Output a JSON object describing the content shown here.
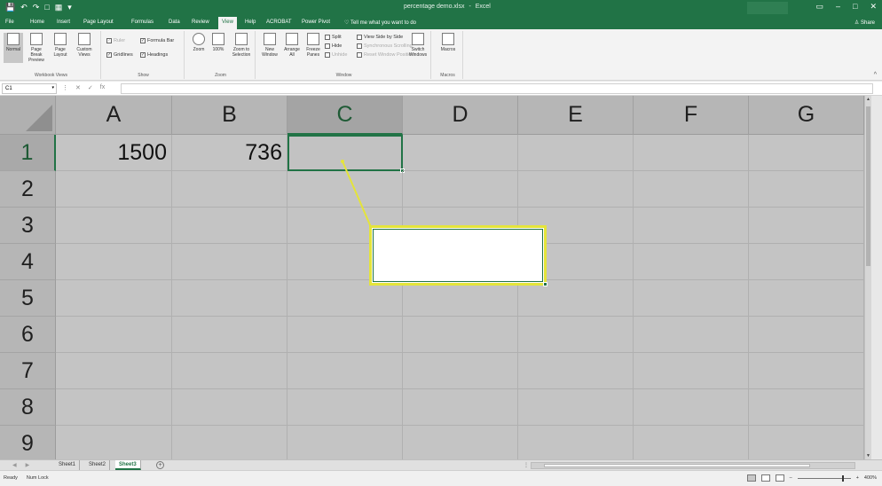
{
  "window": {
    "title": "percentage demo.xlsx",
    "app": "Excel",
    "title_sep": "-",
    "qat": [
      "💾",
      "↶",
      "↷",
      "□",
      "▦",
      "▾"
    ],
    "controls": [
      "▭",
      "–",
      "□",
      "✕"
    ]
  },
  "ribbon_tabs": [
    "File",
    "Home",
    "Insert",
    "Page Layout",
    "Formulas",
    "Data",
    "Review",
    "View",
    "Help",
    "ACROBAT",
    "Power Pivot"
  ],
  "active_tab": "View",
  "tell_me": "Tell me what you want to do",
  "share": "Share",
  "ribbon": {
    "workbook_views": {
      "label": "Workbook Views",
      "buttons": [
        "Normal",
        "Page Break Preview",
        "Page Layout",
        "Custom Views"
      ]
    },
    "show": {
      "label": "Show",
      "items": [
        {
          "label": "Ruler",
          "checked": true,
          "disabled": true
        },
        {
          "label": "Formula Bar",
          "checked": true
        },
        {
          "label": "Gridlines",
          "checked": true
        },
        {
          "label": "Headings",
          "checked": true
        }
      ]
    },
    "zoom": {
      "label": "Zoom",
      "buttons": [
        "Zoom",
        "100%",
        "Zoom to Selection"
      ]
    },
    "window": {
      "label": "Window",
      "buttons": [
        "New Window",
        "Arrange All",
        "Freeze Panes"
      ],
      "small": [
        "Split",
        "Hide",
        "Unhide"
      ],
      "side": [
        "View Side by Side",
        "Synchronous Scrolling",
        "Reset Window Position"
      ],
      "switch": "Switch Windows"
    },
    "macros": {
      "label": "Macros",
      "button": "Macros"
    }
  },
  "formula_bar": {
    "name_box": "C1",
    "fx": "fx",
    "value": ""
  },
  "grid": {
    "columns": [
      "A",
      "B",
      "C",
      "D",
      "E",
      "F",
      "G"
    ],
    "rows": [
      "1",
      "2",
      "3",
      "4",
      "5",
      "6",
      "7",
      "8",
      "9"
    ],
    "selected_column": "C",
    "selected_row": "1",
    "cells": {
      "A1": "1500",
      "B1": "736"
    }
  },
  "sheets": {
    "tabs": [
      "Sheet1",
      "Sheet2",
      "Sheet3"
    ],
    "active": "Sheet3",
    "add": "+"
  },
  "status": {
    "ready": "Ready",
    "num_lock": "Num Lock",
    "zoom_level": "400%"
  },
  "colors": {
    "excel_green": "#217346",
    "callout_yellow": "#e4e43a",
    "grid_dim": "#c4c4c4"
  }
}
